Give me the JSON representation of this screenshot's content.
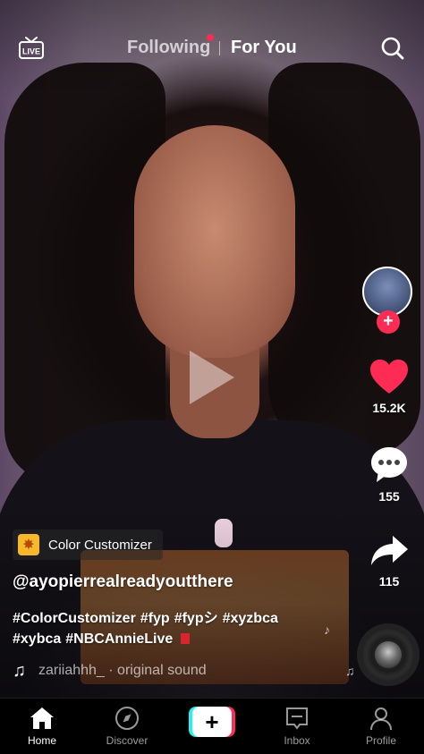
{
  "header": {
    "live_label": "LIVE",
    "tabs": [
      {
        "label": "Following",
        "active": false,
        "has_notification": true
      },
      {
        "label": "For You",
        "active": true
      }
    ]
  },
  "icons": {
    "live": "live-tv-icon",
    "search": "search-icon",
    "play": "play-icon",
    "like": "heart-icon",
    "comment": "comment-bubble-icon",
    "share": "share-arrow-icon",
    "music": "music-note-icon",
    "home": "home-icon",
    "discover": "compass-icon",
    "create": "plus-icon",
    "inbox": "inbox-icon",
    "profile": "person-icon"
  },
  "rail": {
    "follow_symbol": "+",
    "likes": "15.2K",
    "comments": "155",
    "shares": "115"
  },
  "post": {
    "effect_label": "Color Customizer",
    "username": "@ayopierrealreadyoutthere",
    "hashtags_line1": [
      "#ColorCustomizer",
      "#fyp",
      "#fypシ",
      "#xyzbca"
    ],
    "hashtags_line2": [
      "#xybca",
      "#NBCAnnieLive"
    ],
    "sound": "zariiahhh_ · original sound"
  },
  "nav": {
    "home": "Home",
    "discover": "Discover",
    "create": "+",
    "inbox": "Inbox",
    "profile": "Profile"
  },
  "colors": {
    "accent_red": "#fe2c55",
    "accent_cyan": "#25f4ee",
    "like_active": "#fe2c55",
    "effect_badge": "#f7b82b"
  }
}
